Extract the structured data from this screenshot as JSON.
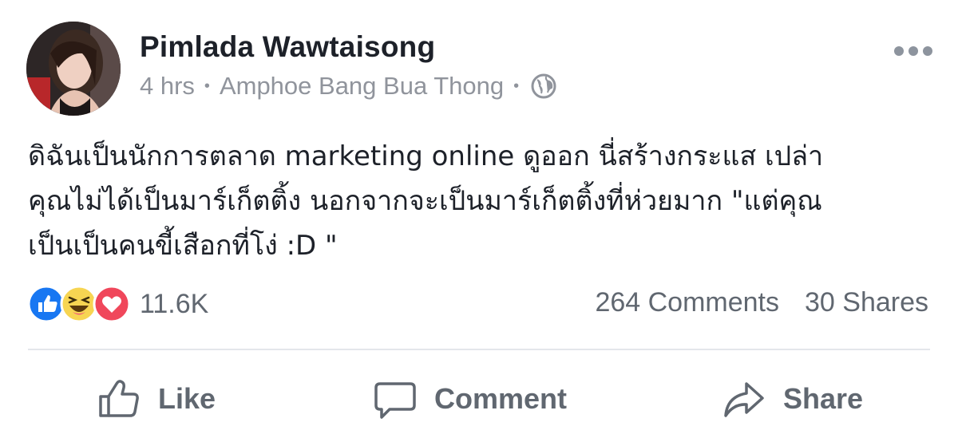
{
  "post": {
    "author": "Pimlada Wawtaisong",
    "time": "4 hrs",
    "location": "Amphoe Bang Bua Thong",
    "privacy_icon": "globe-icon",
    "text_lines": [
      "ดิฉันเป็นนักการตลาด marketing online ดูออก นี่สร้างกระแส เปล่า",
      "คุณไม่ได้เป็นมาร์เก็ตติ้ง นอกจากจะเป็นมาร์เก็ตติ้งที่ห่วยมาก \"แต่คุณ",
      "เป็นเป็นคนขี้เสือกที่โง่ :D \""
    ]
  },
  "reactions": {
    "icons": [
      "like-icon",
      "haha-icon",
      "love-icon"
    ],
    "count": "11.6K"
  },
  "stats": {
    "comments": "264 Comments",
    "shares": "30 Shares"
  },
  "actions": {
    "like": "Like",
    "comment": "Comment",
    "share": "Share"
  },
  "colors": {
    "like_blue": "#1877f2",
    "haha_yellow": "#f7d552",
    "love_red": "#f0475b",
    "text_dark": "#1d2129",
    "text_gray": "#606770"
  }
}
